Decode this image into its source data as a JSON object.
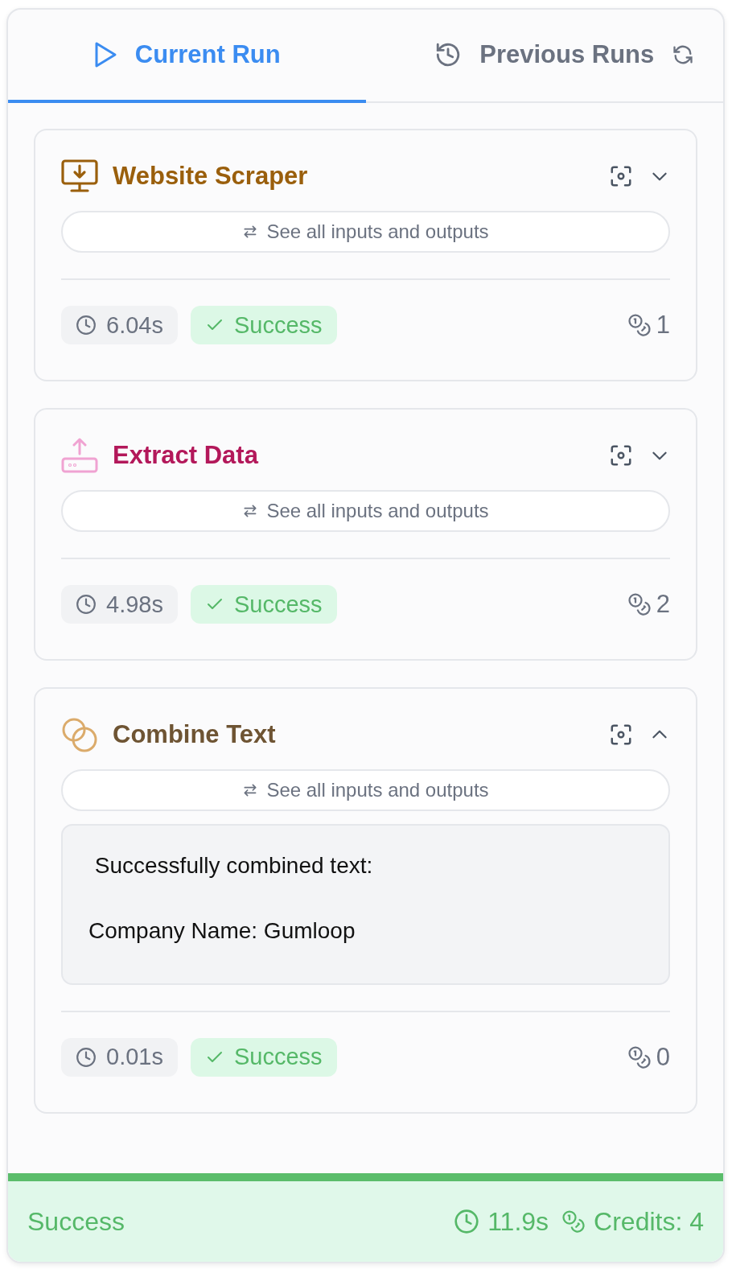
{
  "tabs": [
    {
      "label": "Current Run",
      "kind": "play",
      "selected": true
    },
    {
      "label": "Previous Runs",
      "kind": "history",
      "selected": false
    }
  ],
  "steps": [
    {
      "title": "Website Scraper",
      "kind": "monitor",
      "color": "#9a5f0c",
      "io_button": "See all inputs and outputs",
      "expanded": false,
      "duration": "6.04s",
      "status": "Success",
      "credits": "1"
    },
    {
      "title": "Extract Data",
      "kind": "upload",
      "color": "#b3185a",
      "io_button": "See all inputs and outputs",
      "expanded": false,
      "duration": "4.98s",
      "status": "Success",
      "credits": "2"
    },
    {
      "title": "Combine Text",
      "kind": "circles",
      "color": "#6e5433",
      "io_button": "See all inputs and outputs",
      "expanded": true,
      "output": " Successfully combined text:\n\nCompany Name: Gumloop",
      "duration": "0.01s",
      "status": "Success",
      "credits": "0"
    }
  ],
  "footer": {
    "status": "Success",
    "duration": "11.9s",
    "credits": "Credits: 4"
  }
}
